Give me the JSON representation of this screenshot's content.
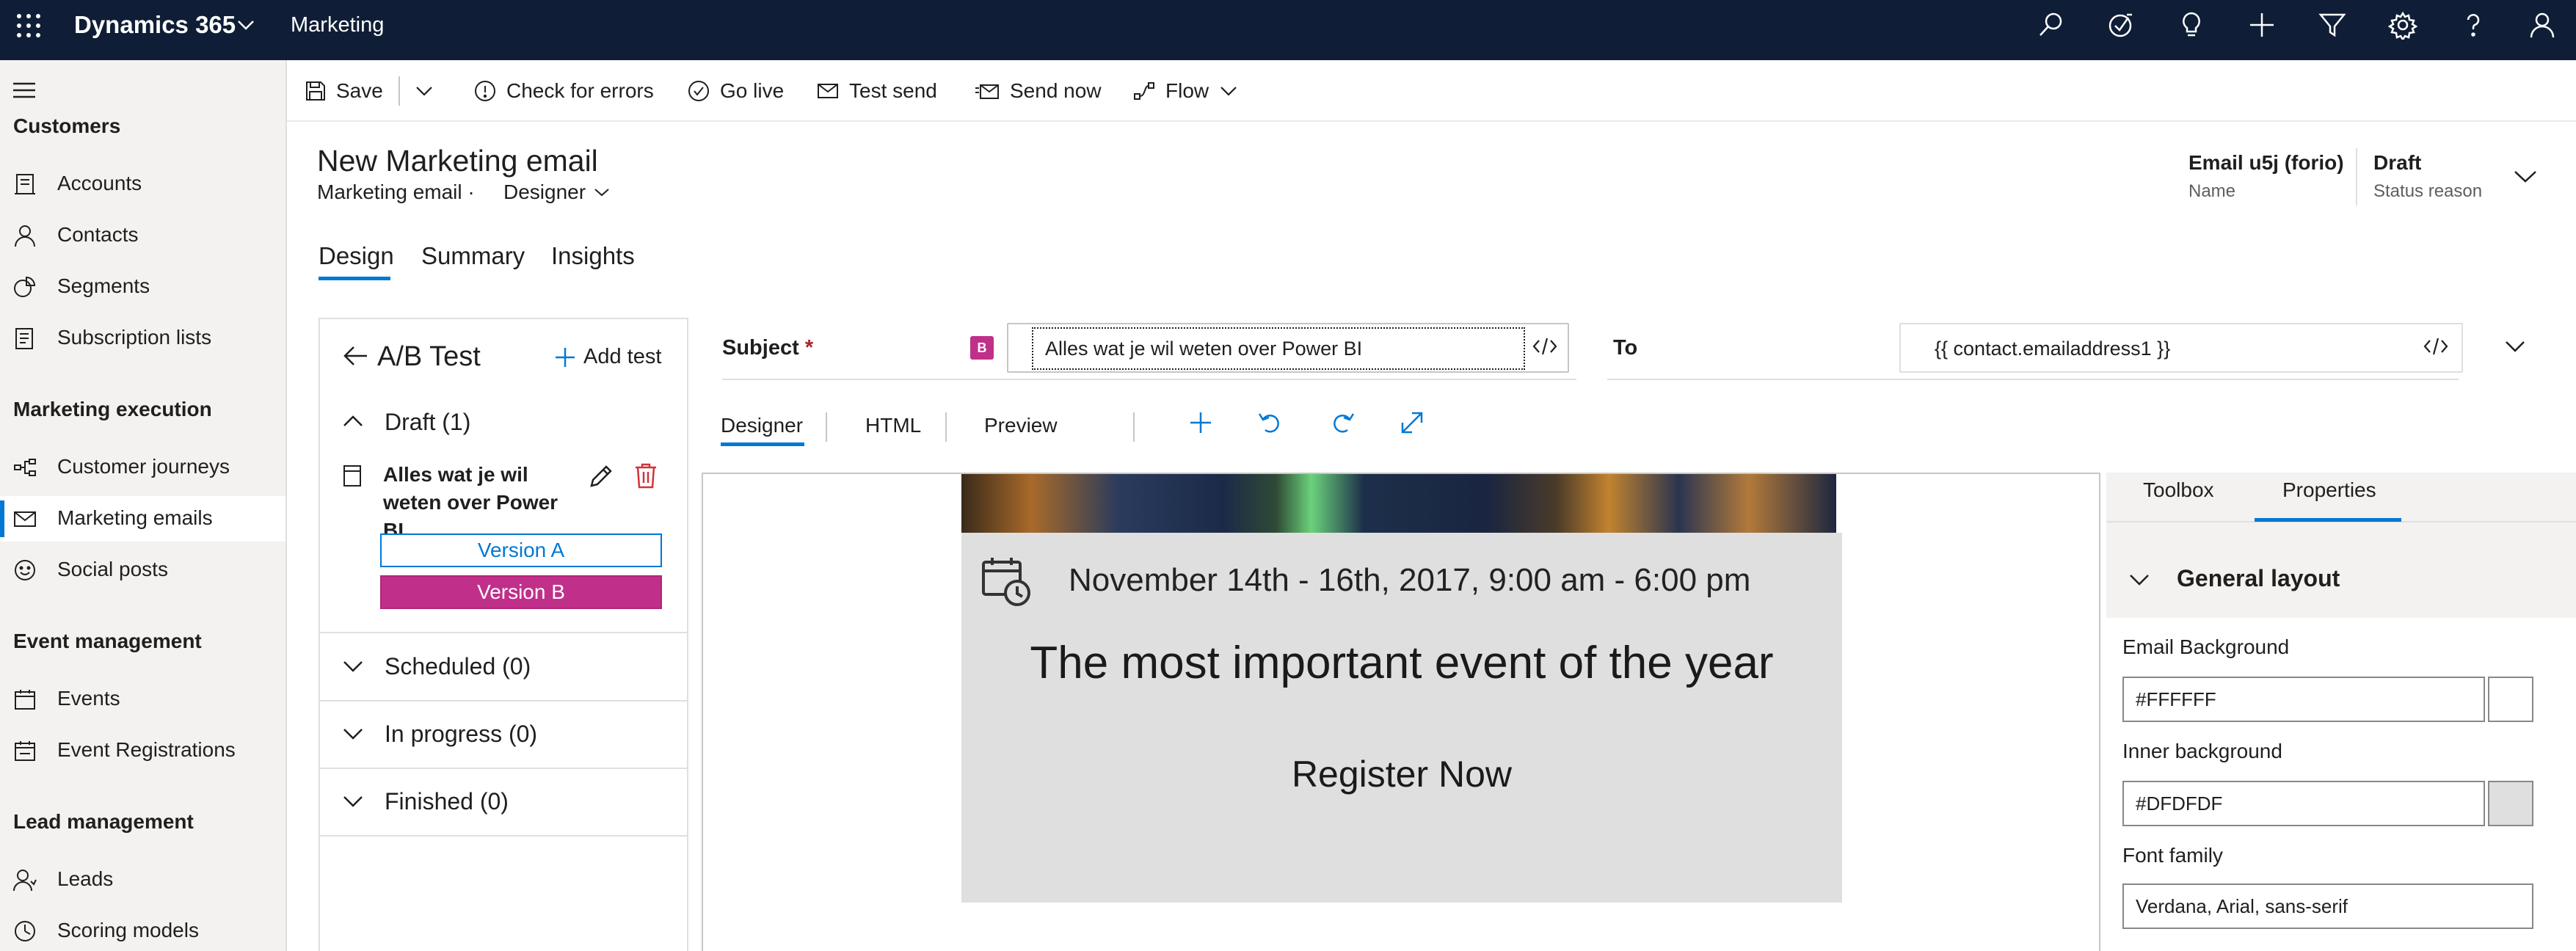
{
  "topbar": {
    "app_name": "Dynamics 365",
    "area_name": "Marketing",
    "icons": [
      "search-icon",
      "task-icon",
      "lightbulb-icon",
      "plus-icon",
      "filter-icon",
      "gear-icon",
      "help-icon",
      "user-icon"
    ]
  },
  "sidebar": {
    "groups": [
      {
        "label": "Customers",
        "items": [
          {
            "label": "Accounts",
            "icon": "accounts-icon"
          },
          {
            "label": "Contacts",
            "icon": "contact-icon"
          },
          {
            "label": "Segments",
            "icon": "segments-icon"
          },
          {
            "label": "Subscription lists",
            "icon": "list-icon"
          }
        ]
      },
      {
        "label": "Marketing execution",
        "items": [
          {
            "label": "Customer journeys",
            "icon": "journey-icon"
          },
          {
            "label": "Marketing emails",
            "icon": "mail-icon",
            "selected": true
          },
          {
            "label": "Social posts",
            "icon": "social-icon"
          }
        ]
      },
      {
        "label": "Event management",
        "items": [
          {
            "label": "Events",
            "icon": "calendar-icon"
          },
          {
            "label": "Event Registrations",
            "icon": "registration-icon"
          }
        ]
      },
      {
        "label": "Lead management",
        "items": [
          {
            "label": "Leads",
            "icon": "leads-icon"
          },
          {
            "label": "Scoring models",
            "icon": "scoring-icon"
          }
        ]
      }
    ]
  },
  "commandbar": {
    "save": "Save",
    "check_errors": "Check for errors",
    "go_live": "Go live",
    "test_send": "Test send",
    "send_now": "Send now",
    "flow": "Flow"
  },
  "record": {
    "title": "New Marketing email",
    "entity": "Marketing email",
    "separator": "·",
    "form": "Designer",
    "name_value": "Email u5j (forio)",
    "name_label": "Name",
    "status_value": "Draft",
    "status_label": "Status reason"
  },
  "tabs": [
    "Design",
    "Summary",
    "Insights"
  ],
  "abtest": {
    "title": "A/B Test",
    "add_label": "Add test",
    "draft_label": "Draft (1)",
    "item_title": "Alles wat je wil weten over Power BI",
    "version_a": "Version A",
    "version_b": "Version B",
    "sections": [
      "Scheduled (0)",
      "In progress (0)",
      "Finished (0)"
    ]
  },
  "subject": {
    "label": "Subject",
    "required_mark": "*",
    "badge": "B",
    "value": "Alles wat je wil weten over Power BI"
  },
  "to": {
    "label": "To",
    "value": "{{ contact.emailaddress1 }}"
  },
  "designer": {
    "tabs": [
      "Designer",
      "HTML",
      "Preview"
    ]
  },
  "email_content": {
    "event_date": "November 14th - 16th, 2017, 9:00 am - 6:00 pm",
    "headline": "The most important event of the year",
    "cta": "Register Now"
  },
  "properties": {
    "tabs": [
      "Toolbox",
      "Properties"
    ],
    "section": "General layout",
    "email_background_label": "Email Background",
    "email_background_value": "#FFFFFF",
    "inner_background_label": "Inner background",
    "inner_background_value": "#DFDFDF",
    "font_family_label": "Font family",
    "font_family_value": "Verdana, Arial, sans-serif"
  },
  "colors": {
    "topbar": "#0f1e36",
    "accent": "#0078d4",
    "version_b": "#c0308a",
    "inner_background": "#DFDFDF"
  }
}
